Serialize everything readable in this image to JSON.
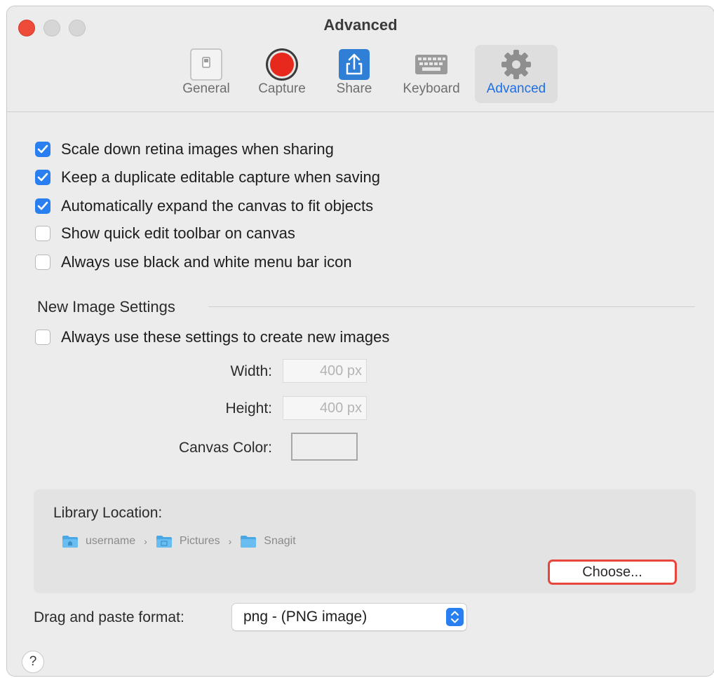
{
  "window": {
    "title": "Advanced"
  },
  "toolbar": {
    "tabs": [
      {
        "label": "General",
        "icon": "general-switch-icon"
      },
      {
        "label": "Capture",
        "icon": "capture-record-icon"
      },
      {
        "label": "Share",
        "icon": "share-icon"
      },
      {
        "label": "Keyboard",
        "icon": "keyboard-icon"
      },
      {
        "label": "Advanced",
        "icon": "gear-icon",
        "active": true
      }
    ]
  },
  "options": [
    {
      "label": "Scale down retina images when sharing",
      "checked": true
    },
    {
      "label": "Keep a duplicate editable capture when saving",
      "checked": true
    },
    {
      "label": "Automatically expand the canvas to fit objects",
      "checked": true
    },
    {
      "label": "Show quick edit toolbar on canvas",
      "checked": false
    },
    {
      "label": "Always use black and white menu bar icon",
      "checked": false
    }
  ],
  "new_image": {
    "section_title": "New Image Settings",
    "always_use_label": "Always use these settings to create new images",
    "always_use_checked": false,
    "width_label": "Width:",
    "width_value": "400 px",
    "height_label": "Height:",
    "height_value": "400 px",
    "canvas_color_label": "Canvas Color:",
    "canvas_color": "#eeeeee"
  },
  "library": {
    "title": "Library Location:",
    "path": [
      "username",
      "Pictures",
      "Snagit"
    ],
    "choose_label": "Choose..."
  },
  "drag_paste": {
    "label": "Drag and paste format:",
    "value": "png - (PNG image)"
  },
  "help": {
    "label": "?"
  },
  "colors": {
    "accent": "#2a7ff0",
    "close": "#ee4b3b",
    "highlight_border": "#e8453c",
    "active_tab_text": "#1e6fe3"
  }
}
